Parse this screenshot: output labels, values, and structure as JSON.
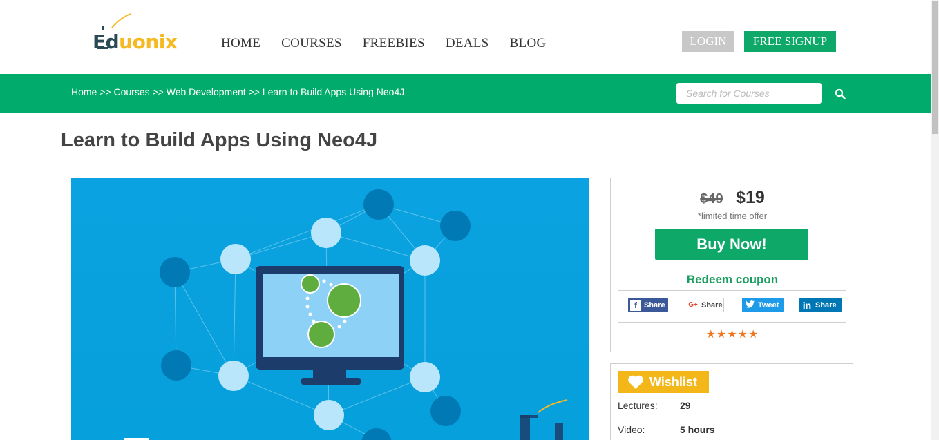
{
  "header": {
    "logo": {
      "part1": "Ed",
      "part2": "u",
      "part3": "onix"
    },
    "nav": [
      "HOME",
      "COURSES",
      "FREEBIES",
      "DEALS",
      "BLOG"
    ],
    "login_label": "LOGIN",
    "signup_label": "FREE SIGNUP"
  },
  "greenbar": {
    "breadcrumb": "Home >> Courses >> Web Development >> Learn to Build Apps Using Neo4J",
    "search_placeholder": "Search for Courses"
  },
  "page": {
    "title": "Learn to Build Apps Using Neo4J"
  },
  "pricing": {
    "old_price": "$49",
    "new_price": "$19",
    "offer_note": "*limited time offer",
    "buy_label": "Buy Now!",
    "redeem_label": "Redeem coupon",
    "share": {
      "facebook": "Share",
      "google": "Share",
      "twitter": "Tweet",
      "linkedin": "Share"
    },
    "rating_stars": 5,
    "stars_text": "★★★★★"
  },
  "course_info": {
    "wishlist_label": "Wishlist",
    "rows": [
      {
        "label": "Lectures:",
        "value": "29"
      },
      {
        "label": "Video:",
        "value": "5 hours"
      }
    ]
  },
  "colors": {
    "brand_green": "#00ab6b",
    "button_green": "#0ea868",
    "wishlist_yellow": "#f3b719",
    "star_orange": "#f07722",
    "hero_blue": "#06a0dc"
  }
}
